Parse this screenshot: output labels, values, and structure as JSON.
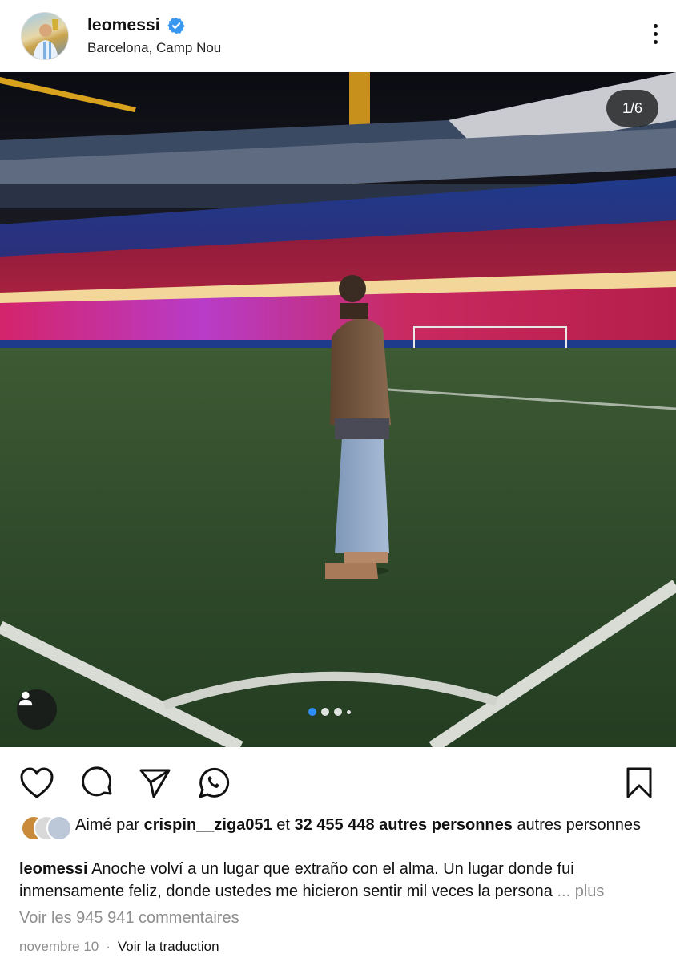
{
  "post": {
    "username": "leomessi",
    "location": "Barcelona, Camp Nou",
    "image_counter": "1/6",
    "carousel_dots": 4,
    "carousel_active_index": 0
  },
  "actions": {
    "like_icon": "heart-icon",
    "comment_icon": "comment-icon",
    "share_icon": "send-icon",
    "whatsapp_icon": "whatsapp-icon",
    "save_icon": "bookmark-icon"
  },
  "likes": {
    "prefix": "Aimé par ",
    "user": "crispin__ziga051",
    "middle": " et ",
    "count": "32 455 448 autres personnes",
    "suffix": " autres personnes"
  },
  "caption": {
    "username": "leomessi",
    "text": " Anoche volví a un lugar que extraño con el alma. Un lugar donde fui inmensamente feliz, donde ustedes me hicieron sentir mil veces la persona",
    "more": "... plus"
  },
  "comments_link": "Voir les 945 941 commentaires",
  "footer": {
    "date": "novembre 10",
    "separator": "·",
    "translate": "Voir la traduction"
  },
  "colors": {
    "verified": "#3897f0",
    "active_dot": "#2f8fff",
    "muted": "#8e8e8e"
  }
}
